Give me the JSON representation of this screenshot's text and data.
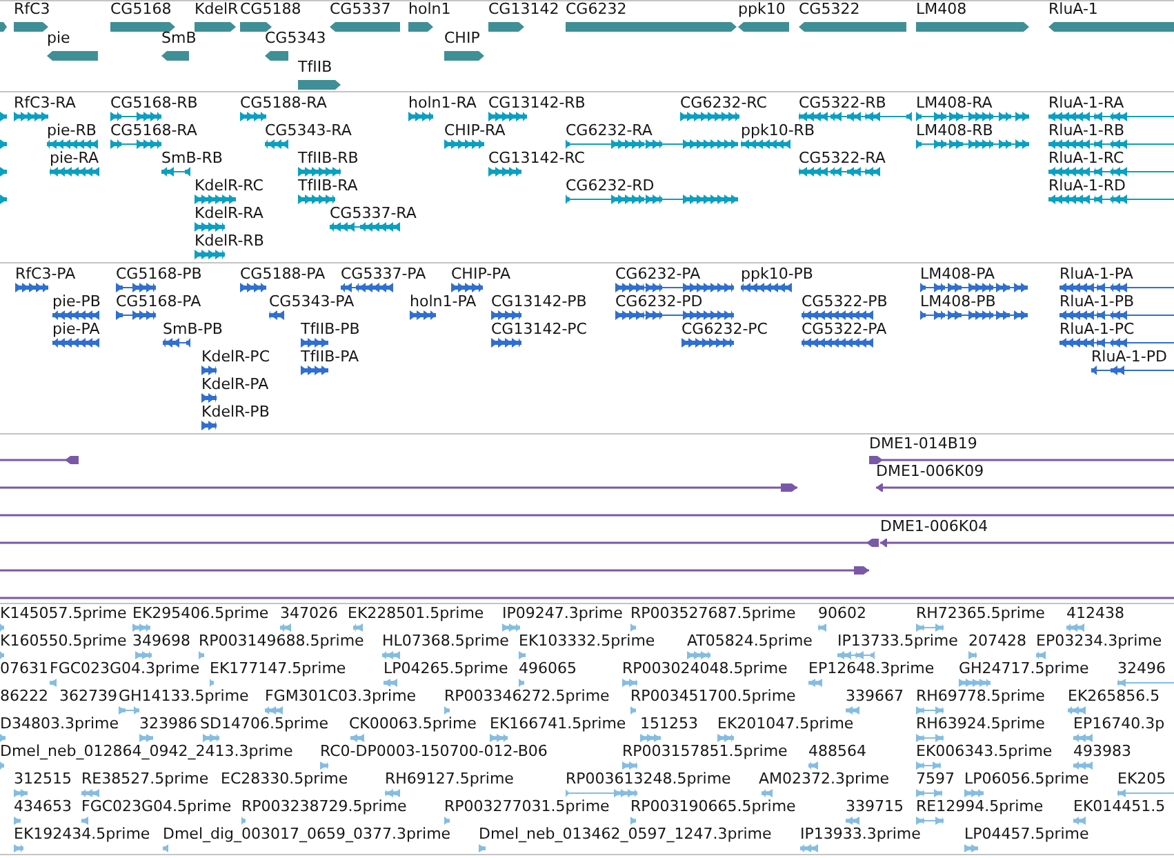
{
  "tracks": [
    {
      "kind": "gene",
      "features": [
        {
          "reverse": false
        },
        {
          "label": "RfC3",
          "reverse": false
        },
        {
          "label": "CG5168",
          "reverse": false
        },
        {
          "label": "KdelR",
          "reverse": false
        },
        {
          "label": "CG5188",
          "reverse": false
        },
        {
          "label": "CG5337",
          "reverse": true
        },
        {
          "label": "holn1",
          "reverse": false
        },
        {
          "label": "CG13142",
          "reverse": false
        },
        {
          "label": "CG6232",
          "reverse": false
        },
        {
          "label": "ppk10",
          "reverse": true
        },
        {
          "label": "CG5322",
          "reverse": true
        },
        {
          "label": "LM408",
          "reverse": false
        },
        {
          "label": "RluA-1",
          "reverse": true
        },
        {
          "label": "pie",
          "reverse": true
        },
        {
          "label": "SmB",
          "reverse": true
        },
        {
          "label": "CG5343",
          "reverse": true
        },
        {
          "label": "CHIP",
          "reverse": false
        },
        {
          "label": "TfIIB",
          "reverse": false
        }
      ]
    },
    {
      "kind": "transcript",
      "features": [
        {
          "reverse": false
        },
        {
          "label": "RfC3-RA",
          "reverse": false
        },
        {
          "label": "CG5168-RB",
          "reverse": false
        },
        {
          "label": "CG5188-RA",
          "reverse": false
        },
        {
          "label": "holn1-RA",
          "reverse": false
        },
        {
          "label": "CG13142-RB",
          "reverse": false
        },
        {
          "label": "CG6232-RC",
          "reverse": false
        },
        {
          "label": "CG5322-RB",
          "reverse": true
        },
        {
          "label": "LM408-RA",
          "reverse": false
        },
        {
          "label": "RluA-1-RA",
          "reverse": true
        },
        {
          "reverse": false
        },
        {
          "label": "pie-RB",
          "reverse": true
        },
        {
          "label": "CG5168-RA",
          "reverse": false
        },
        {
          "label": "CG5343-RA",
          "reverse": true
        },
        {
          "label": "CHIP-RA",
          "reverse": false
        },
        {
          "label": "CG6232-RA",
          "reverse": false
        },
        {
          "label": "ppk10-RB",
          "reverse": true
        },
        {
          "label": "LM408-RB",
          "reverse": false
        },
        {
          "label": "RluA-1-RB",
          "reverse": true
        },
        {
          "reverse": false
        },
        {
          "label": "pie-RA",
          "reverse": true
        },
        {
          "label": "SmB-RB",
          "reverse": true
        },
        {
          "label": "TfIIB-RB",
          "reverse": false
        },
        {
          "label": "CG13142-RC",
          "reverse": false
        },
        {
          "label": "CG5322-RA",
          "reverse": true
        },
        {
          "label": "RluA-1-RC",
          "reverse": true
        },
        {
          "reverse": false
        },
        {
          "label": "KdelR-RC",
          "reverse": false
        },
        {
          "label": "TfIIB-RA",
          "reverse": false
        },
        {
          "label": "CG6232-RD",
          "reverse": false
        },
        {
          "label": "RluA-1-RD",
          "reverse": true
        },
        {
          "label": "KdelR-RA",
          "reverse": false
        },
        {
          "label": "CG5337-RA",
          "reverse": true
        },
        {
          "label": "KdelR-RB",
          "reverse": false
        }
      ]
    },
    {
      "kind": "protein",
      "features": [
        {
          "label": "RfC3-PA",
          "reverse": false
        },
        {
          "label": "CG5168-PB",
          "reverse": false
        },
        {
          "label": "CG5188-PA",
          "reverse": false
        },
        {
          "label": "CG5337-PA",
          "reverse": true
        },
        {
          "label": "CHIP-PA",
          "reverse": false
        },
        {
          "label": "CG6232-PA",
          "reverse": false
        },
        {
          "label": "ppk10-PB",
          "reverse": true
        },
        {
          "label": "LM408-PA",
          "reverse": false
        },
        {
          "label": "RluA-1-PA",
          "reverse": true
        },
        {
          "label": "pie-PB",
          "reverse": true
        },
        {
          "label": "CG5168-PA",
          "reverse": false
        },
        {
          "label": "CG5343-PA",
          "reverse": true
        },
        {
          "label": "holn1-PA",
          "reverse": false
        },
        {
          "label": "CG13142-PB",
          "reverse": false
        },
        {
          "label": "CG6232-PD",
          "reverse": false
        },
        {
          "label": "CG5322-PB",
          "reverse": true
        },
        {
          "label": "LM408-PB",
          "reverse": false
        },
        {
          "label": "RluA-1-PB",
          "reverse": true
        },
        {
          "label": "pie-PA",
          "reverse": true
        },
        {
          "label": "SmB-PB",
          "reverse": true
        },
        {
          "label": "TfIIB-PB",
          "reverse": false
        },
        {
          "label": "CG13142-PC",
          "reverse": false
        },
        {
          "label": "CG6232-PC",
          "reverse": false
        },
        {
          "label": "CG5322-PA",
          "reverse": true
        },
        {
          "label": "RluA-1-PC",
          "reverse": true
        },
        {
          "label": "KdelR-PC",
          "reverse": false
        },
        {
          "label": "TfIIB-PA",
          "reverse": false
        },
        {
          "label": "RluA-1-PD",
          "reverse": true
        },
        {
          "label": "KdelR-PA",
          "reverse": false
        },
        {
          "label": "KdelR-PB",
          "reverse": false
        }
      ]
    },
    {
      "kind": "clone",
      "features": [
        {
          "kind": "headed",
          "reverse": true
        },
        {
          "kind": "headed",
          "label": "DME1-014B19",
          "reverse": false
        },
        {
          "kind": "headed",
          "reverse": false
        },
        {
          "kind": "headed",
          "label": "DME1-006K09",
          "reverse": true
        },
        {
          "kind": "plain"
        },
        {
          "kind": "headed",
          "reverse": true
        },
        {
          "kind": "headed",
          "label": "DME1-006K04",
          "reverse": true
        },
        {
          "kind": "headed",
          "reverse": false
        },
        {
          "kind": "plain"
        }
      ]
    },
    {
      "kind": "est",
      "features": [
        {
          "label": "K145057.5prime",
          "reverse": false
        },
        {
          "label": "EK295406.5prime",
          "reverse": false
        },
        {
          "label": "347026",
          "reverse": true
        },
        {
          "label": "EK228501.5prime",
          "reverse": true
        },
        {
          "label": "IP09247.3prime",
          "reverse": false
        },
        {
          "label": "RP003527687.5prime",
          "reverse": false
        },
        {
          "label": "90602",
          "reverse": true
        },
        {
          "label": "RH72365.5prime",
          "reverse": false
        },
        {
          "label": "412438",
          "reverse": true
        },
        {
          "label": "K160550.5prime",
          "reverse": false
        },
        {
          "label": "349698",
          "reverse": false
        },
        {
          "label": "RP003149688.5prime",
          "reverse": false
        },
        {
          "label": "HL07368.5prime",
          "reverse": true
        },
        {
          "label": "EK103332.5prime",
          "reverse": false
        },
        {
          "label": "AT05824.5prime",
          "reverse": false
        },
        {
          "label": "IP13733.5prime",
          "reverse": true
        },
        {
          "label": "207428",
          "reverse": false
        },
        {
          "label": "EP03234.3prime",
          "reverse": true
        },
        {
          "label": "07631"
        },
        {
          "label": "FGC023G04.3prime",
          "reverse": true
        },
        {
          "label": "EK177147.5prime",
          "reverse": false
        },
        {
          "label": "LP04265.5prime",
          "reverse": true
        },
        {
          "label": "496065",
          "reverse": false
        },
        {
          "label": "RP003024048.5prime",
          "reverse": false
        },
        {
          "label": "EP12648.3prime",
          "reverse": true
        },
        {
          "label": "GH24717.5prime",
          "reverse": false
        },
        {
          "label": "32496",
          "reverse": true
        },
        {
          "label": "86222"
        },
        {
          "label": "362739"
        },
        {
          "label": "GH14133.5prime",
          "reverse": false
        },
        {
          "label": "FGM301C03.3prime",
          "reverse": true
        },
        {
          "label": "RP003346272.5prime",
          "reverse": false
        },
        {
          "label": "RP003451700.5prime",
          "reverse": false
        },
        {
          "label": "339667",
          "reverse": true
        },
        {
          "label": "RH69778.5prime",
          "reverse": false
        },
        {
          "label": "EK265856.5",
          "reverse": true
        },
        {
          "label": "D34803.3prime",
          "reverse": false
        },
        {
          "label": "323986",
          "reverse": false
        },
        {
          "label": "SD14706.5prime",
          "reverse": false
        },
        {
          "label": "CK00063.5prime",
          "reverse": true
        },
        {
          "label": "EK166741.5prime",
          "reverse": false
        },
        {
          "label": "151253",
          "reverse": false
        },
        {
          "label": "EK201047.5prime",
          "reverse": false
        },
        {
          "label": "RH63924.5prime",
          "reverse": false
        },
        {
          "label": "EP16740.3p",
          "reverse": true
        },
        {
          "label": "Dmel_neb_012864_0942_2413.3prime",
          "reverse": false
        },
        {
          "label": "RC0-DP0003-150700-012-B06",
          "reverse": false
        },
        {
          "label": "RP003157851.5prime",
          "reverse": false
        },
        {
          "label": "488564",
          "reverse": true
        },
        {
          "label": "EK006343.5prime",
          "reverse": false
        },
        {
          "label": "493983",
          "reverse": true
        },
        {
          "label": "312515",
          "reverse": false
        },
        {
          "label": "RE38527.5prime",
          "reverse": true
        },
        {
          "label": "EC28330.5prime"
        },
        {
          "label": "RH69127.5prime",
          "reverse": true
        },
        {
          "label": "RP003613248.5prime",
          "reverse": false
        },
        {
          "label": "AM02372.3prime",
          "reverse": true
        },
        {
          "label": "7597",
          "reverse": false
        },
        {
          "label": "LP06056.5prime",
          "reverse": false
        },
        {
          "label": "EK205",
          "reverse": true
        },
        {
          "label": "434653",
          "reverse": false
        },
        {
          "label": "FGC023G04.5prime",
          "reverse": true
        },
        {
          "label": "RP003238729.5prime",
          "reverse": false
        },
        {
          "label": "RP003277031.5prime",
          "reverse": false
        },
        {
          "label": "RP003190665.5prime",
          "reverse": false
        },
        {
          "label": "339715",
          "reverse": true
        },
        {
          "label": "RE12994.5prime",
          "reverse": false
        },
        {
          "label": "EK014451.5",
          "reverse": true
        },
        {
          "label": "EK192434.5prime",
          "reverse": false
        },
        {
          "label": "Dmel_dig_003017_0659_0377.3prime",
          "reverse": true
        },
        {
          "label": "Dmel_neb_013462_0597_1247.3prime",
          "reverse": false
        },
        {
          "label": "IP13933.3prime",
          "reverse": true
        },
        {
          "label": "LP04457.5prime",
          "reverse": false
        }
      ]
    }
  ]
}
